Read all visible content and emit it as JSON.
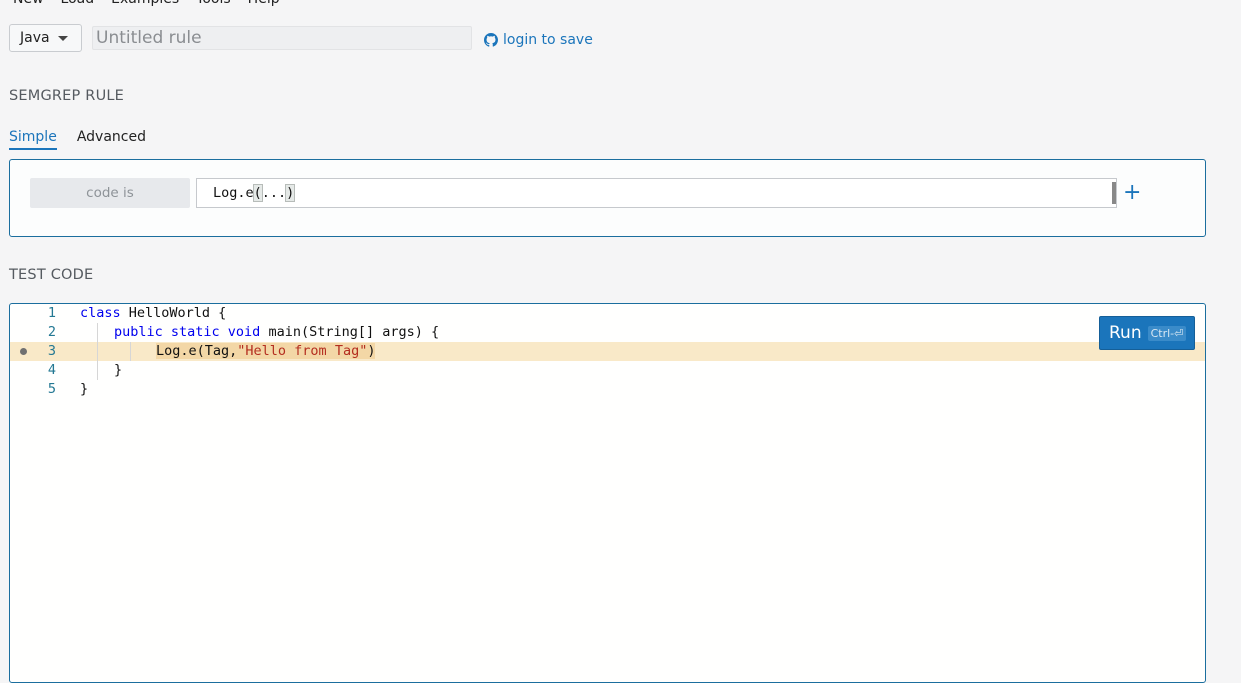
{
  "menu": {
    "items": [
      "New",
      "Load",
      "Examples",
      "Tools",
      "Help"
    ]
  },
  "toolbar": {
    "language": "Java",
    "rule_title_placeholder": "Untitled rule",
    "login_label": "login to save"
  },
  "rule_section": {
    "heading": "SEMGREP RULE",
    "tabs": [
      {
        "label": "Simple",
        "active": true
      },
      {
        "label": "Advanced",
        "active": false
      }
    ],
    "condition_label": "code is",
    "pattern_prefix": "Log.e",
    "pattern_open": "(",
    "pattern_args": "...",
    "pattern_close": ")",
    "add_label": "+"
  },
  "test_section": {
    "heading": "TEST CODE",
    "run_label": "Run",
    "run_shortcut": "Ctrl-⏎",
    "lines": [
      {
        "number": "1"
      },
      {
        "number": "2"
      },
      {
        "number": "3",
        "highlighted": true
      },
      {
        "number": "4"
      },
      {
        "number": "5"
      }
    ],
    "code": {
      "l1_kw": "class",
      "l1_rest": " HelloWorld {",
      "l2_kw": "public static void",
      "l2_rest": " main(String[] args) {",
      "l3_call": "Log.e(Tag,",
      "l3_str": "\"Hello from Tag\"",
      "l3_close": ")",
      "l4": "}",
      "l5": "}"
    }
  },
  "colors": {
    "accent": "#1b75bb",
    "highlight_line": "#f9e9c8",
    "keyword": "#0000ee",
    "string": "#b42e1f"
  }
}
